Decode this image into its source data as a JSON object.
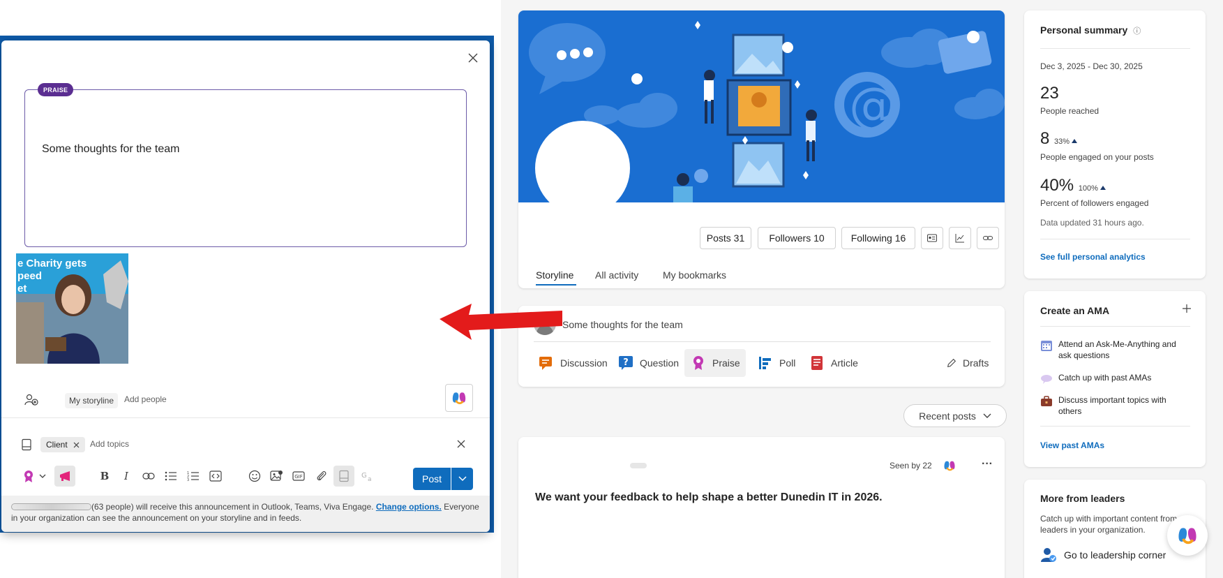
{
  "dialog": {
    "badge": "PRAISE",
    "editor_text": "Some thoughts for the team",
    "attachment_caption": "e Charity gets\npeed\net",
    "audience_chip": "My storyline",
    "add_people": "Add people",
    "topic_chip": "Client",
    "add_topics": "Add topics",
    "post_label": "Post",
    "notice_prefix": "(63 people) will receive this announcement in Outlook, Teams, Viva Engage.",
    "notice_link": "Change options.",
    "notice_suffix": "Everyone in your organization can see the announcement on your storyline and in feeds."
  },
  "profile": {
    "stats": [
      "Posts 31",
      "Followers 10",
      "Following 16"
    ],
    "tabs": [
      "Storyline",
      "All activity",
      "My bookmarks"
    ]
  },
  "composer": {
    "placeholder": "Some thoughts for the team",
    "types": [
      "Discussion",
      "Question",
      "Praise",
      "Poll",
      "Article"
    ],
    "drafts": "Drafts",
    "selected_type": "Praise"
  },
  "feed": {
    "sort_label": "Recent posts",
    "post": {
      "seen_by": "Seen by 22",
      "more": "···",
      "title": "We want your feedback to help shape a better Dunedin IT in 2026."
    }
  },
  "summary": {
    "title": "Personal summary",
    "info_icon": "ⓘ",
    "date_range": "Dec 3, 2025 - Dec 30, 2025",
    "reached_value": "23",
    "reached_label": "People reached",
    "engaged_value": "8",
    "engaged_delta": "33%",
    "engaged_label": "People engaged on your posts",
    "followers_value": "40%",
    "followers_delta": "100%",
    "followers_label": "Percent of followers engaged",
    "updated": "Data updated 31 hours ago.",
    "analytics_link": "See full personal analytics"
  },
  "ama": {
    "title": "Create an AMA",
    "items": [
      "Attend an Ask-Me-Anything and ask questions",
      "Catch up with past AMAs",
      "Discuss important topics with others"
    ],
    "link": "View past AMAs"
  },
  "leaders": {
    "title": "More from leaders",
    "desc": "Catch up with important content from leaders in your organization.",
    "link": "Go to leadership corner"
  },
  "colors": {
    "brand": "#0f6cbd",
    "praise_badge": "#5b2e91",
    "arrow": "#e31b1b",
    "banner": "#1a6ed1"
  }
}
